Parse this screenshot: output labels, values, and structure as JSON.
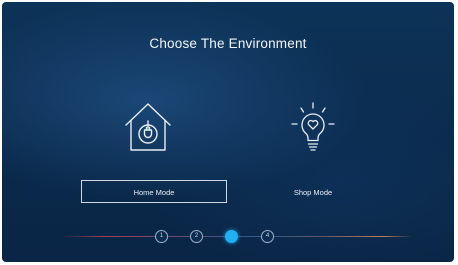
{
  "screen": {
    "title": "Choose The Environment"
  },
  "modes": [
    {
      "label": "Home Mode",
      "icon": "house-plug-icon",
      "selected": true
    },
    {
      "label": "Shop Mode",
      "icon": "lightbulb-heart-icon",
      "selected": false
    }
  ],
  "steps": {
    "items": [
      "1",
      "2",
      "3",
      "4"
    ],
    "current": 3
  },
  "colors": {
    "accent": "#23aef0",
    "background": "#0c2f53",
    "text": "#f2f6fb"
  }
}
